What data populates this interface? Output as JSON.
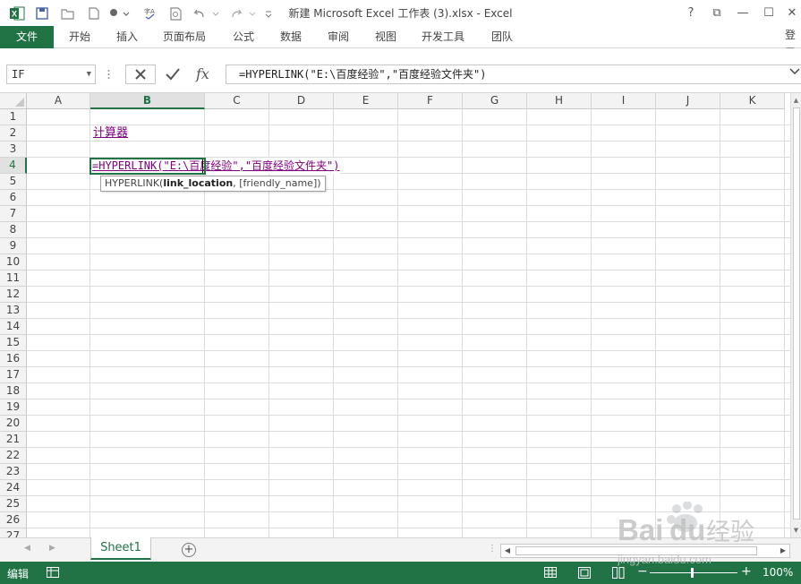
{
  "window": {
    "title": "新建 Microsoft Excel 工作表 (3).xlsx - Excel",
    "help": "?",
    "ribbon_options": "⧉",
    "minimize": "—",
    "maximize": "☐",
    "close": "✕"
  },
  "quick_access": [
    "save-icon",
    "open-icon",
    "new-icon",
    "touch-mode-icon",
    "spelling-icon",
    "print-preview-icon",
    "undo-icon",
    "redo-icon",
    "customize-icon"
  ],
  "ribbon": {
    "tabs": [
      "文件",
      "开始",
      "插入",
      "页面布局",
      "公式",
      "数据",
      "审阅",
      "视图",
      "开发工具",
      "团队"
    ],
    "login": "登录"
  },
  "formula_bar": {
    "name_box": "IF",
    "formula": "=HYPERLINK(\"E:\\百度经验\",\"百度经验文件夹\")"
  },
  "grid": {
    "columns": [
      "A",
      "B",
      "C",
      "D",
      "E",
      "F",
      "G",
      "H",
      "I",
      "J",
      "K"
    ],
    "active_column": "B",
    "rows": [
      "1",
      "2",
      "3",
      "4",
      "5",
      "6",
      "7",
      "8",
      "9",
      "10",
      "11",
      "12",
      "13",
      "14",
      "15",
      "16",
      "17",
      "18",
      "19",
      "20",
      "21",
      "22",
      "23",
      "24",
      "25",
      "26",
      "27"
    ],
    "active_row": "4",
    "cells": {
      "B2": "计算器",
      "B4": "=HYPERLINK(\"E:\\百度经验\",\"百度经验文件夹\")"
    },
    "tooltip": {
      "func": "HYPERLINK(",
      "arg1": "link_location",
      "rest": ", [friendly_name])"
    }
  },
  "sheets": {
    "tabs": [
      "Sheet1"
    ],
    "active": "Sheet1",
    "add_label": "+"
  },
  "status": {
    "mode": "编辑",
    "zoom_level": "100%",
    "zoom_minus": "−",
    "zoom_plus": "+"
  },
  "watermark": {
    "text": "Baidu经验",
    "url": "jingyan.baidu.com"
  },
  "colors": {
    "accent": "#217346",
    "hyperlink": "#800080"
  }
}
